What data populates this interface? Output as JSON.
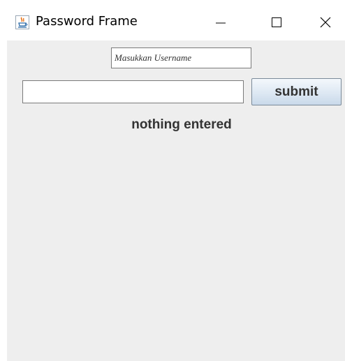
{
  "window": {
    "title": "Password Frame",
    "app_icon": "java-cup-icon",
    "controls": {
      "minimize_icon": "minimize-icon",
      "maximize_icon": "maximize-icon",
      "close_icon": "close-icon"
    }
  },
  "form": {
    "username_field": {
      "value": "Masukkan Username"
    },
    "password_field": {
      "value": ""
    },
    "submit_label": "submit",
    "status_text": "nothing entered"
  },
  "colors": {
    "content_background": "#eeeeee",
    "titlebar_background": "#ffffff",
    "text": "#333333",
    "icon_orange": "#e8741a",
    "icon_blue": "#2b6aa8"
  }
}
